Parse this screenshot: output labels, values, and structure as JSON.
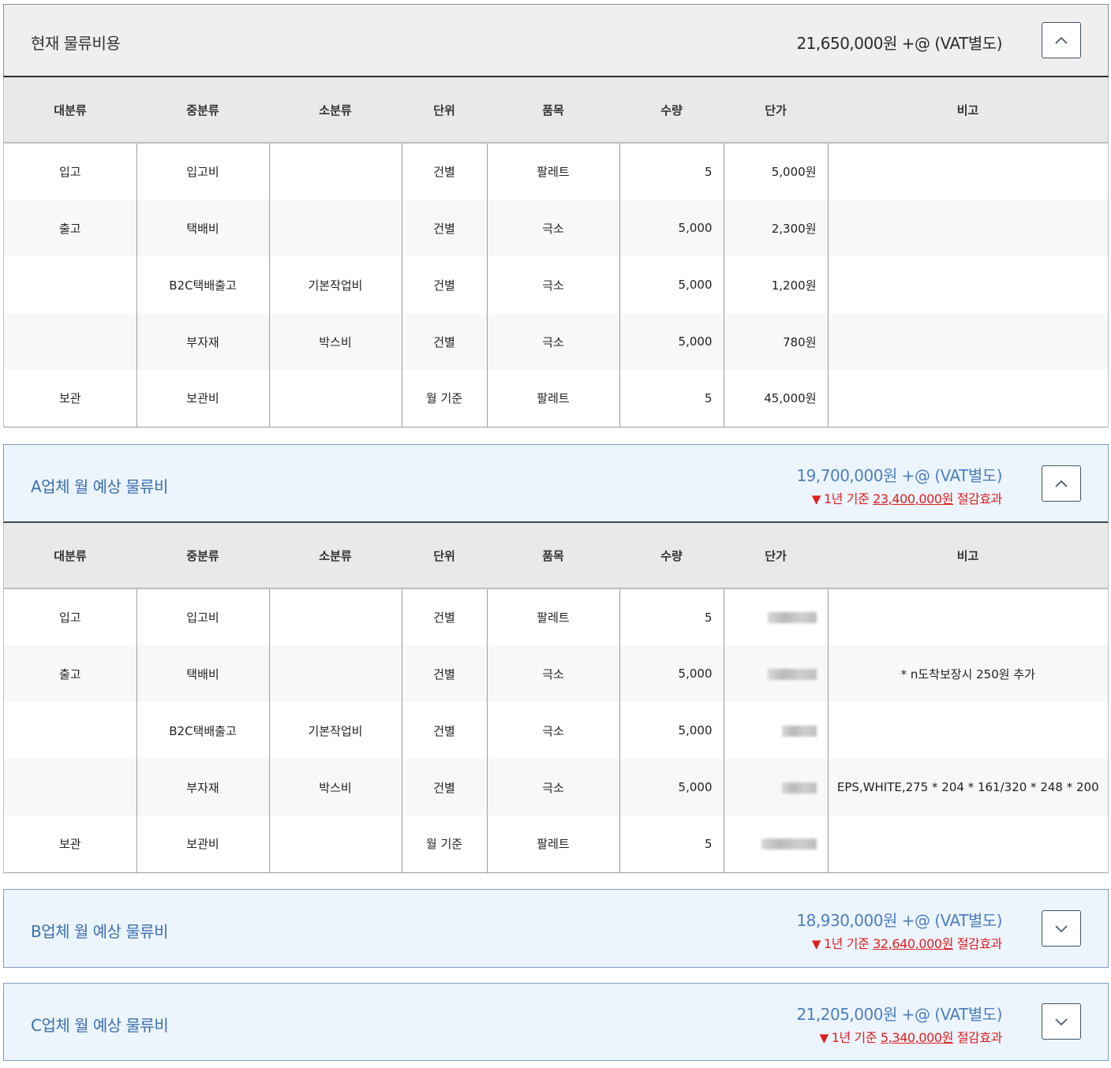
{
  "current": {
    "title": "현재 물류비용",
    "total": "21,650,000원 +@ (VAT별도)",
    "toggle_icon": "chevron-up-icon"
  },
  "columns": [
    "대분류",
    "중분류",
    "소분류",
    "단위",
    "품목",
    "수량",
    "단가",
    "비고"
  ],
  "current_rows": [
    {
      "major": "입고",
      "mid": "입고비",
      "minor": "",
      "unit": "건별",
      "item": "팔레트",
      "qty": "5",
      "price": "5,000원",
      "note": ""
    },
    {
      "major": "출고",
      "mid": "택배비",
      "minor": "",
      "unit": "건별",
      "item": "극소",
      "qty": "5,000",
      "price": "2,300원",
      "note": ""
    },
    {
      "major": "",
      "mid": "B2C택배출고",
      "minor": "기본작업비",
      "unit": "건별",
      "item": "극소",
      "qty": "5,000",
      "price": "1,200원",
      "note": ""
    },
    {
      "major": "",
      "mid": "부자재",
      "minor": "박스비",
      "unit": "건별",
      "item": "극소",
      "qty": "5,000",
      "price": "780원",
      "note": ""
    },
    {
      "major": "보관",
      "mid": "보관비",
      "minor": "",
      "unit": "월 기준",
      "item": "팔레트",
      "qty": "5",
      "price": "45,000원",
      "note": ""
    }
  ],
  "vendor_a": {
    "title": "A업체 월 예상 물류비",
    "total": "19,700,000원 +@ (VAT별도)",
    "saving_prefix": "1년 기준 ",
    "saving_amount": "23,400,000원",
    "saving_suffix": " 절감효과",
    "toggle_icon": "chevron-up-icon"
  },
  "vendor_a_rows": [
    {
      "major": "입고",
      "mid": "입고비",
      "minor": "",
      "unit": "건별",
      "item": "팔레트",
      "qty": "5",
      "note": ""
    },
    {
      "major": "출고",
      "mid": "택배비",
      "minor": "",
      "unit": "건별",
      "item": "극소",
      "qty": "5,000",
      "note": "* n도착보장시 250원 추가"
    },
    {
      "major": "",
      "mid": "B2C택배출고",
      "minor": "기본작업비",
      "unit": "건별",
      "item": "극소",
      "qty": "5,000",
      "note": ""
    },
    {
      "major": "",
      "mid": "부자재",
      "minor": "박스비",
      "unit": "건별",
      "item": "극소",
      "qty": "5,000",
      "note": "EPS,WHITE,275 * 204 * 161/320 * 248 * 200"
    },
    {
      "major": "보관",
      "mid": "보관비",
      "minor": "",
      "unit": "월 기준",
      "item": "팔레트",
      "qty": "5",
      "note": ""
    }
  ],
  "vendor_b": {
    "title": "B업체 월 예상 물류비",
    "total": "18,930,000원 +@ (VAT별도)",
    "saving_prefix": "1년 기준 ",
    "saving_amount": "32,640,000원",
    "saving_suffix": " 절감효과",
    "toggle_icon": "chevron-down-icon"
  },
  "vendor_c": {
    "title": "C업체 월 예상 물류비",
    "total": "21,205,000원 +@ (VAT별도)",
    "saving_prefix": "1년 기준 ",
    "saving_amount": "5,340,000원",
    "saving_suffix": " 절감효과",
    "toggle_icon": "chevron-down-icon"
  },
  "colors": {
    "saving_red": "#e01e1e",
    "vendor_blue": "#3b6fb0",
    "vendor_bg": "#ecf4fd"
  }
}
